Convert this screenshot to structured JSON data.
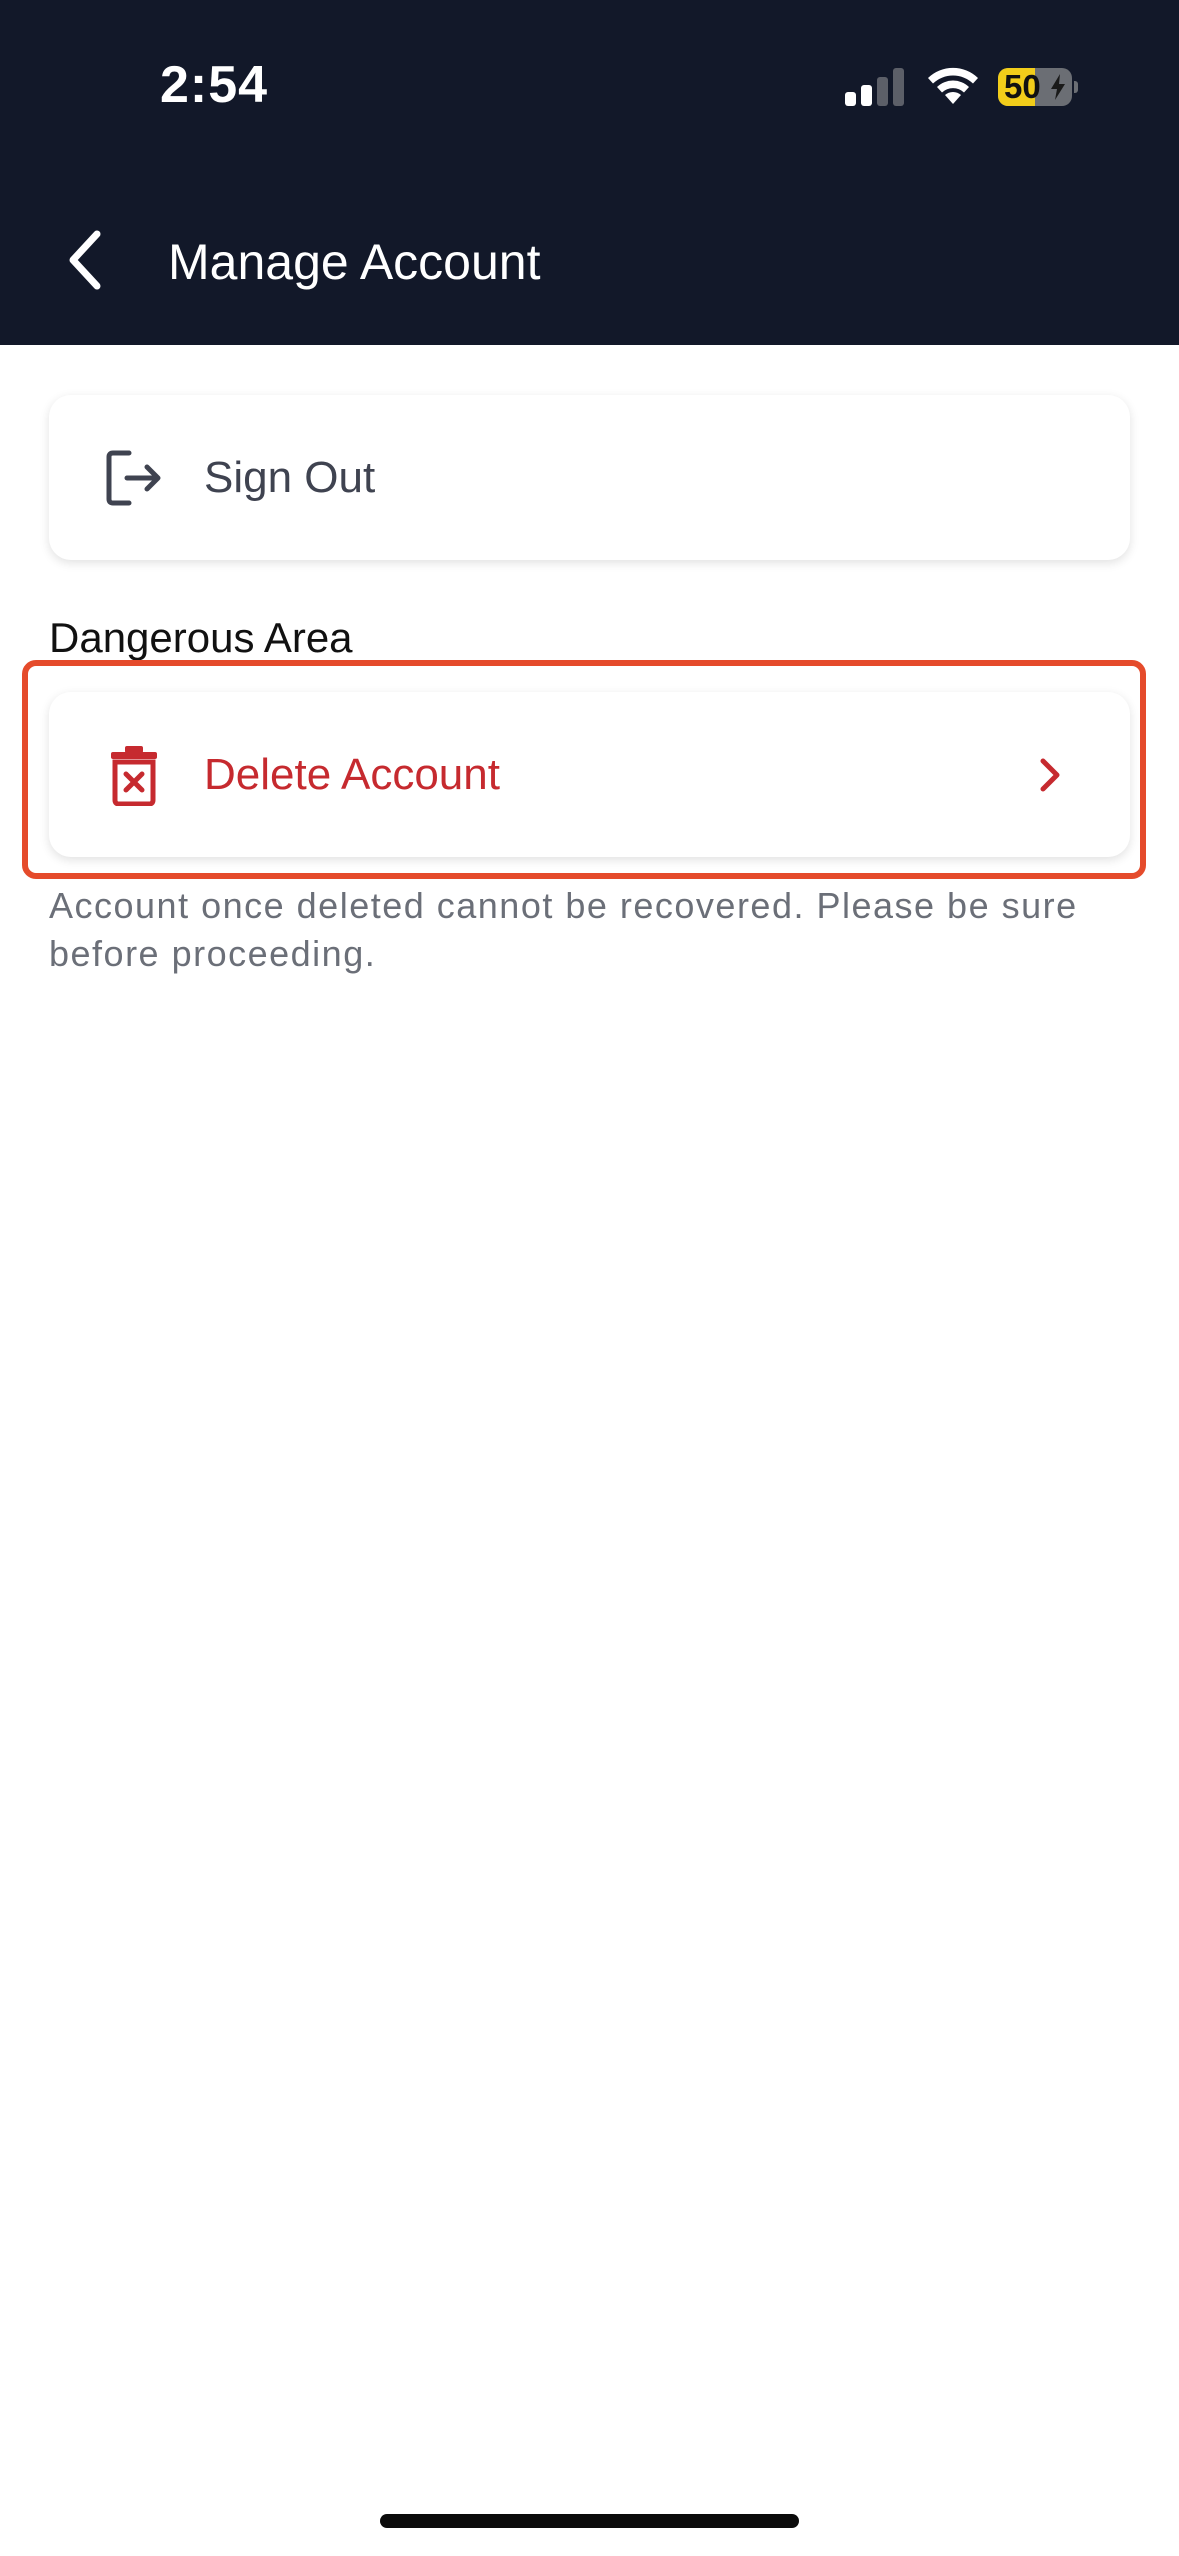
{
  "status_bar": {
    "time": "2:54",
    "battery_level": "50",
    "battery_fraction": 0.5,
    "signal_bars_active": 2,
    "signal_bars_total": 4
  },
  "nav": {
    "title": "Manage Account",
    "back_icon": "chevron-left-icon"
  },
  "sign_out": {
    "label": "Sign Out",
    "icon": "logout-icon"
  },
  "danger_section": {
    "title": "Dangerous Area",
    "delete_label": "Delete Account",
    "delete_icon": "trash-icon",
    "chevron_icon": "chevron-right-icon",
    "warning": "Account once deleted cannot be recovered. Please be sure before proceeding."
  },
  "colors": {
    "header_bg": "#121829",
    "danger": "#c62a2f",
    "highlight_border": "#e54b2b",
    "battery_fill": "#f2cd1a"
  }
}
